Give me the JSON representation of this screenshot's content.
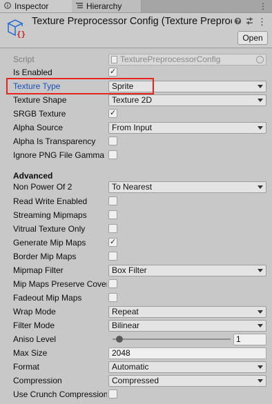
{
  "tabs": [
    {
      "label": "Inspector",
      "icon": "info-icon"
    },
    {
      "label": "Hierarchy",
      "icon": "list-icon"
    }
  ],
  "header": {
    "title": "Texture Preprocessor Config (Texture Preproc",
    "open_label": "Open",
    "tools": [
      "help-icon",
      "preset-icon",
      "menu-icon"
    ]
  },
  "script": {
    "label": "Script",
    "value": "TexturePreprocessorConfig"
  },
  "fields": {
    "is_enabled": {
      "label": "Is Enabled",
      "checked": true
    },
    "texture_type": {
      "label": "Texture Type",
      "value": "Sprite"
    },
    "texture_shape": {
      "label": "Texture Shape",
      "value": "Texture 2D"
    },
    "srgb_texture": {
      "label": "SRGB Texture",
      "checked": true
    },
    "alpha_source": {
      "label": "Alpha Source",
      "value": "From Input"
    },
    "alpha_is_transparency": {
      "label": "Alpha Is Transparency",
      "checked": false
    },
    "ignore_png_gamma": {
      "label": "Ignore PNG File Gamma",
      "checked": false
    }
  },
  "advanced": {
    "title": "Advanced",
    "non_power_of_2": {
      "label": "Non Power Of 2",
      "value": "To Nearest"
    },
    "read_write_enabled": {
      "label": "Read Write Enabled",
      "checked": false
    },
    "streaming_mipmaps": {
      "label": "Streaming Mipmaps",
      "checked": false
    },
    "virtual_texture_only": {
      "label": "Vitrual Texture Only",
      "checked": false
    },
    "generate_mip_maps": {
      "label": "Generate Mip Maps",
      "checked": true
    },
    "border_mip_maps": {
      "label": "Border Mip Maps",
      "checked": false
    },
    "mipmap_filter": {
      "label": "Mipmap Filter",
      "value": "Box Filter"
    },
    "mip_maps_preserve_coverage": {
      "label": "Mip Maps Preserve Coverage",
      "checked": false
    },
    "fadeout_mip_maps": {
      "label": "Fadeout Mip Maps",
      "checked": false
    },
    "wrap_mode": {
      "label": "Wrap Mode",
      "value": "Repeat"
    },
    "filter_mode": {
      "label": "Filter Mode",
      "value": "Bilinear"
    },
    "aniso_level": {
      "label": "Aniso Level",
      "value": "1",
      "slider_fraction": 0.06
    },
    "max_size": {
      "label": "Max Size",
      "value": "2048"
    },
    "format": {
      "label": "Format",
      "value": "Automatic"
    },
    "compression": {
      "label": "Compression",
      "value": "Compressed"
    },
    "use_crunch_compression": {
      "label": "Use Crunch Compression",
      "checked": false
    }
  },
  "colors": {
    "highlight_box": "#e8221c",
    "highlight_label": "#1a4fb8"
  }
}
